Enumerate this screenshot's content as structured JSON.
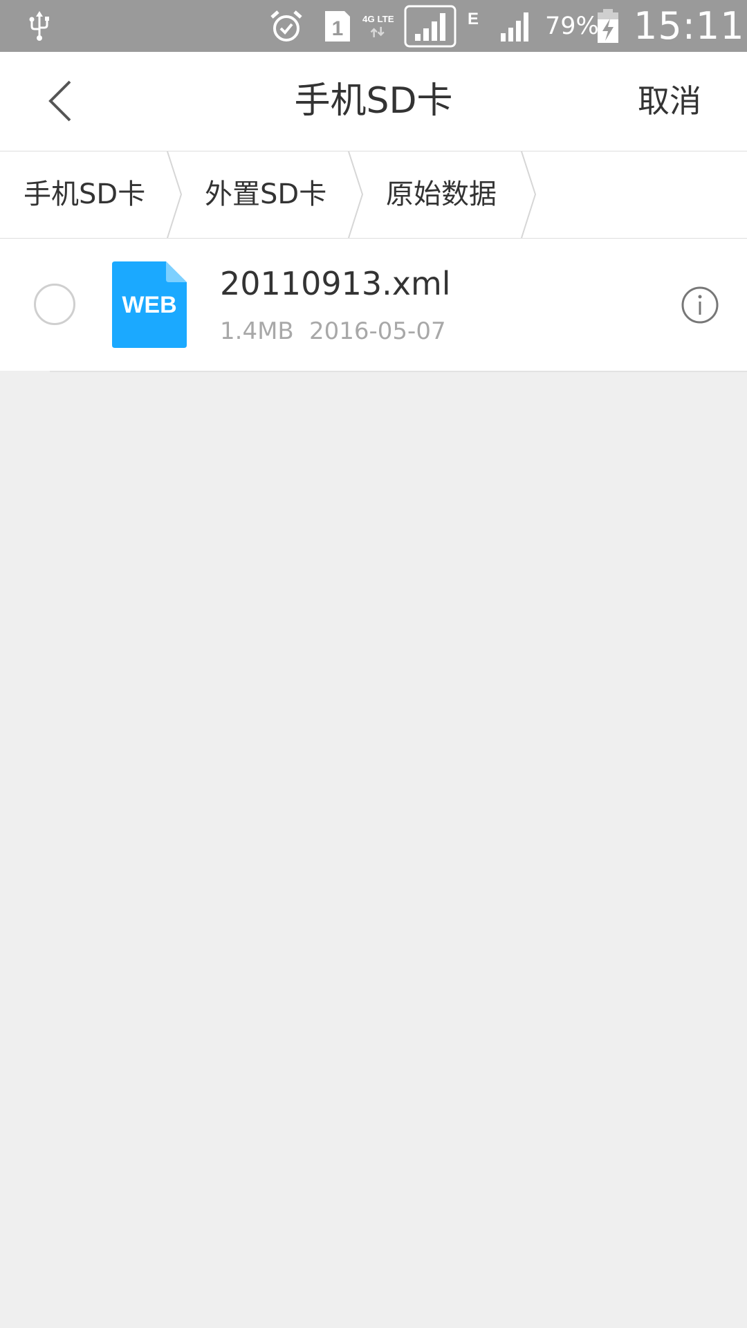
{
  "status_bar": {
    "battery_percent": "79%",
    "time": "15:11",
    "sim_slot": "1",
    "network_type": "4G LTE",
    "data_indicator": "E",
    "icons": [
      "usb-icon",
      "alarm-icon",
      "sim-icon",
      "lte-icon",
      "signal-icon",
      "edge-icon",
      "signal-icon",
      "battery-charging-icon"
    ]
  },
  "header": {
    "title": "手机SD卡",
    "cancel_label": "取消",
    "back_icon": "chevron-left-icon"
  },
  "breadcrumb": {
    "items": [
      {
        "label": "手机SD卡"
      },
      {
        "label": "外置SD卡"
      },
      {
        "label": "原始数据"
      }
    ]
  },
  "files": [
    {
      "name": "20110913.xml",
      "size": "1.4MB",
      "date": "2016-05-07",
      "icon_label": "WEB",
      "icon_color": "#1ba9ff"
    }
  ],
  "colors": {
    "status_bar": "#9a9a9a",
    "background": "#efefef",
    "surface": "#ffffff",
    "file_icon": "#1ba9ff"
  }
}
